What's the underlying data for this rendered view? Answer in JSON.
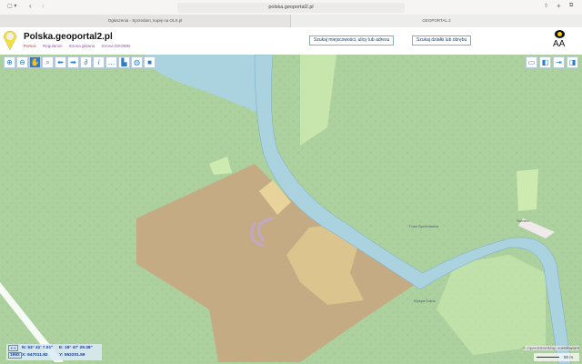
{
  "browser": {
    "url": "polska.geoportal2.pl",
    "tabs": [
      {
        "label": "Ogłoszenia - Sprzedam, kupię na OLX.pl",
        "active": false
      },
      {
        "label": "GEOPORTAL 2",
        "active": true
      }
    ]
  },
  "header": {
    "title": "Polska.geoportal2.pl",
    "links": [
      "Pomoc",
      "Regulamin",
      "Strona główna",
      "Strona GEOBID"
    ],
    "search_address": "Szukaj miejscowości, ulicy lub adresu",
    "search_parcel": "Szukaj działki lub obrębu",
    "font_size": "AA"
  },
  "toolbar": {
    "icons": [
      "zoom-in-icon",
      "zoom-out-icon",
      "pan-hand-icon",
      "zoom-box-icon",
      "back-icon",
      "forward-icon",
      "link-icon",
      "info-icon",
      "measure-icon",
      "print-icon",
      "globe-icon",
      "camera-icon"
    ],
    "active": "pan-hand-icon"
  },
  "map": {
    "labels": [
      "Świniec",
      "Fosa Sprzedawna",
      "Wyspa Dolna"
    ],
    "attribution_prefix": "©",
    "attribution_link": "OpenStreetMap",
    "attribution_suffix": "contributors",
    "scale": "50 m"
  },
  "coords": {
    "n": "N: 53° 41' 7.01\"",
    "e": "E: 18° 47' 29.38\"",
    "x": "X: 647011.82",
    "y": "Y: 552201.59",
    "system": "1992"
  },
  "colors": {
    "forest": "#add19e",
    "water": "#aad3df",
    "parcel": "#c8a47e",
    "meadow": "#cdebb0"
  }
}
